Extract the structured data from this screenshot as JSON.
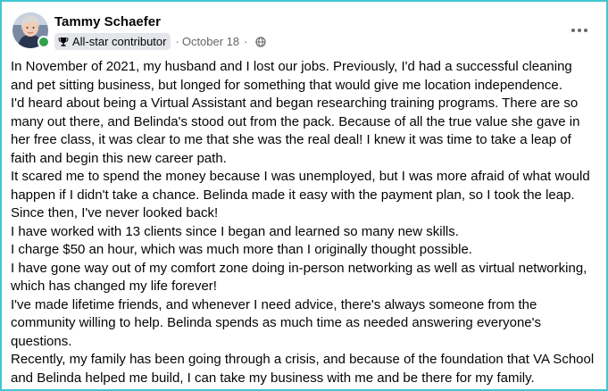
{
  "post": {
    "author": "Tammy Schaefer",
    "badge": "All-star contributor",
    "separator": "·",
    "date": "October 18",
    "separator2": "·",
    "audience_icon": "globe-icon",
    "menu_icon": "more-options-icon",
    "badge_icon": "trophy-icon",
    "paragraphs": [
      "In November of 2021, my husband and I lost our jobs. Previously, I'd had a successful cleaning and pet sitting business, but longed for something that would give me location independence.",
      "I'd heard about being a Virtual Assistant and began researching training programs. There are so many out there, and Belinda's stood out from the pack. Because of all the true value she gave in her free class, it was clear to me that she was the real deal! I knew it was time to take a leap of faith and begin this new career path.",
      "It scared me to spend the money because I was unemployed, but I was more afraid of what would happen if I didn't take a chance. Belinda made it easy with the payment plan, so I took the leap. Since then, I've never looked back!",
      "I have worked with 13 clients since I began and learned so many new skills.",
      "I charge $50 an hour, which was much more than I originally thought possible.",
      "I have gone way out of my comfort zone doing in-person networking as well as virtual networking, which has changed my life forever!",
      "I've made lifetime friends, and whenever I need advice, there's always someone from the community willing to help. Belinda spends as much time as needed answering everyone's questions.",
      "Recently, my family has been going through a crisis, and because of the foundation that VA School and Belinda helped me build, I can take my business with me and be there for my family."
    ]
  },
  "colors": {
    "frame_border": "#41c5d0",
    "online_status": "#31a24c",
    "badge_background": "#e4e6eb",
    "secondary_text": "#65676b"
  }
}
